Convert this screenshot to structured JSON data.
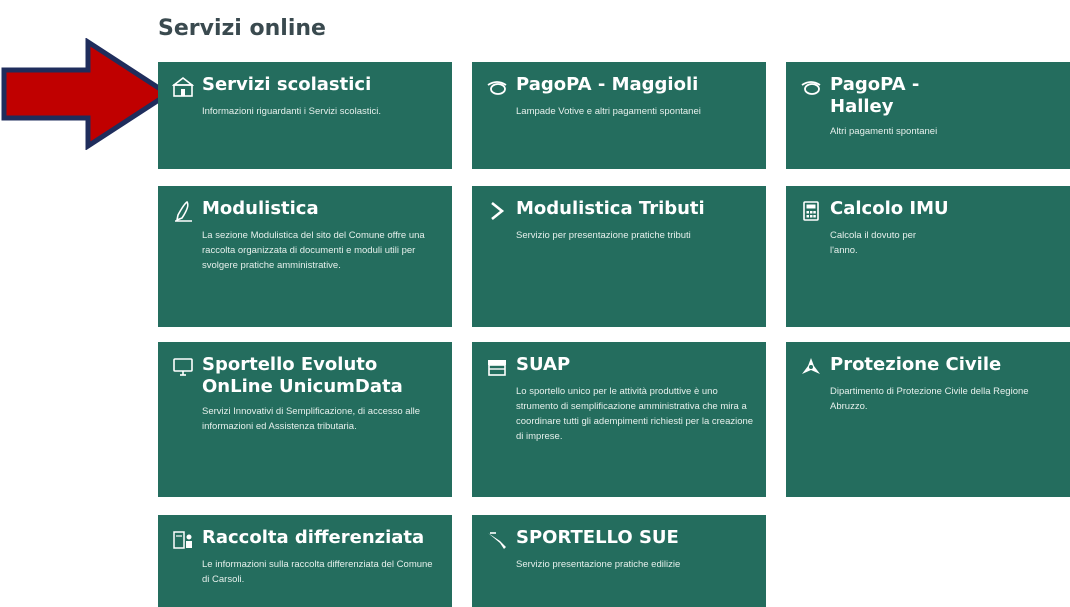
{
  "section": {
    "title": "Servizi online"
  },
  "cards": [
    {
      "title": "Servizi scolastici",
      "desc": "Informazioni riguardanti i Servizi scolastici.",
      "icon": "school-icon"
    },
    {
      "title": "PagoPA - Maggioli",
      "desc": "Lampade Votive e altri pagamenti spontanei",
      "icon": "pagopa-icon"
    },
    {
      "title": "PagoPA - Halley",
      "desc": "Altri pagamenti spontanei",
      "icon": "pagopa-icon"
    },
    {
      "title": "Modulistica",
      "desc": "La sezione Modulistica del sito del Comune offre una raccolta organizzata di documenti e moduli utili per svolgere pratiche amministrative.",
      "icon": "pen-icon"
    },
    {
      "title": "Modulistica Tributi",
      "desc": "Servizio per presentazione pratiche tributi",
      "icon": "chevron-right-icon"
    },
    {
      "title": "Calcolo IMU",
      "desc": "Calcola il dovuto per l'anno.",
      "icon": "calculator-icon"
    },
    {
      "title": "Sportello Evoluto OnLine UnicumData",
      "desc": "Servizi Innovativi di Semplificazione, di accesso alle informazioni ed Assistenza tributaria.",
      "icon": "monitor-icon"
    },
    {
      "title": "SUAP",
      "desc": "Lo sportello unico per le attività produttive è uno strumento di semplificazione amministrativa che mira a coordinare tutti gli adempimenti richiesti per la creazione di imprese.",
      "icon": "shop-icon"
    },
    {
      "title": "Protezione Civile",
      "desc": "Dipartimento di Protezione Civile della Regione Abruzzo.",
      "icon": "civil-protection-icon"
    },
    {
      "title": "Raccolta differenziata",
      "desc": "Le informazioni sulla raccolta differenziata del Comune di Carsoli.",
      "icon": "recycle-icon"
    },
    {
      "title": "SPORTELLO SUE",
      "desc": "Servizio presentazione pratiche edilizie",
      "icon": "building-tool-icon"
    }
  ],
  "annotation": {
    "icon": "red-arrow-icon",
    "color": "#c00000",
    "outline": "#1f2d5c"
  },
  "colors": {
    "card_bg": "#246d5e",
    "title_text": "#3a4a4f"
  }
}
